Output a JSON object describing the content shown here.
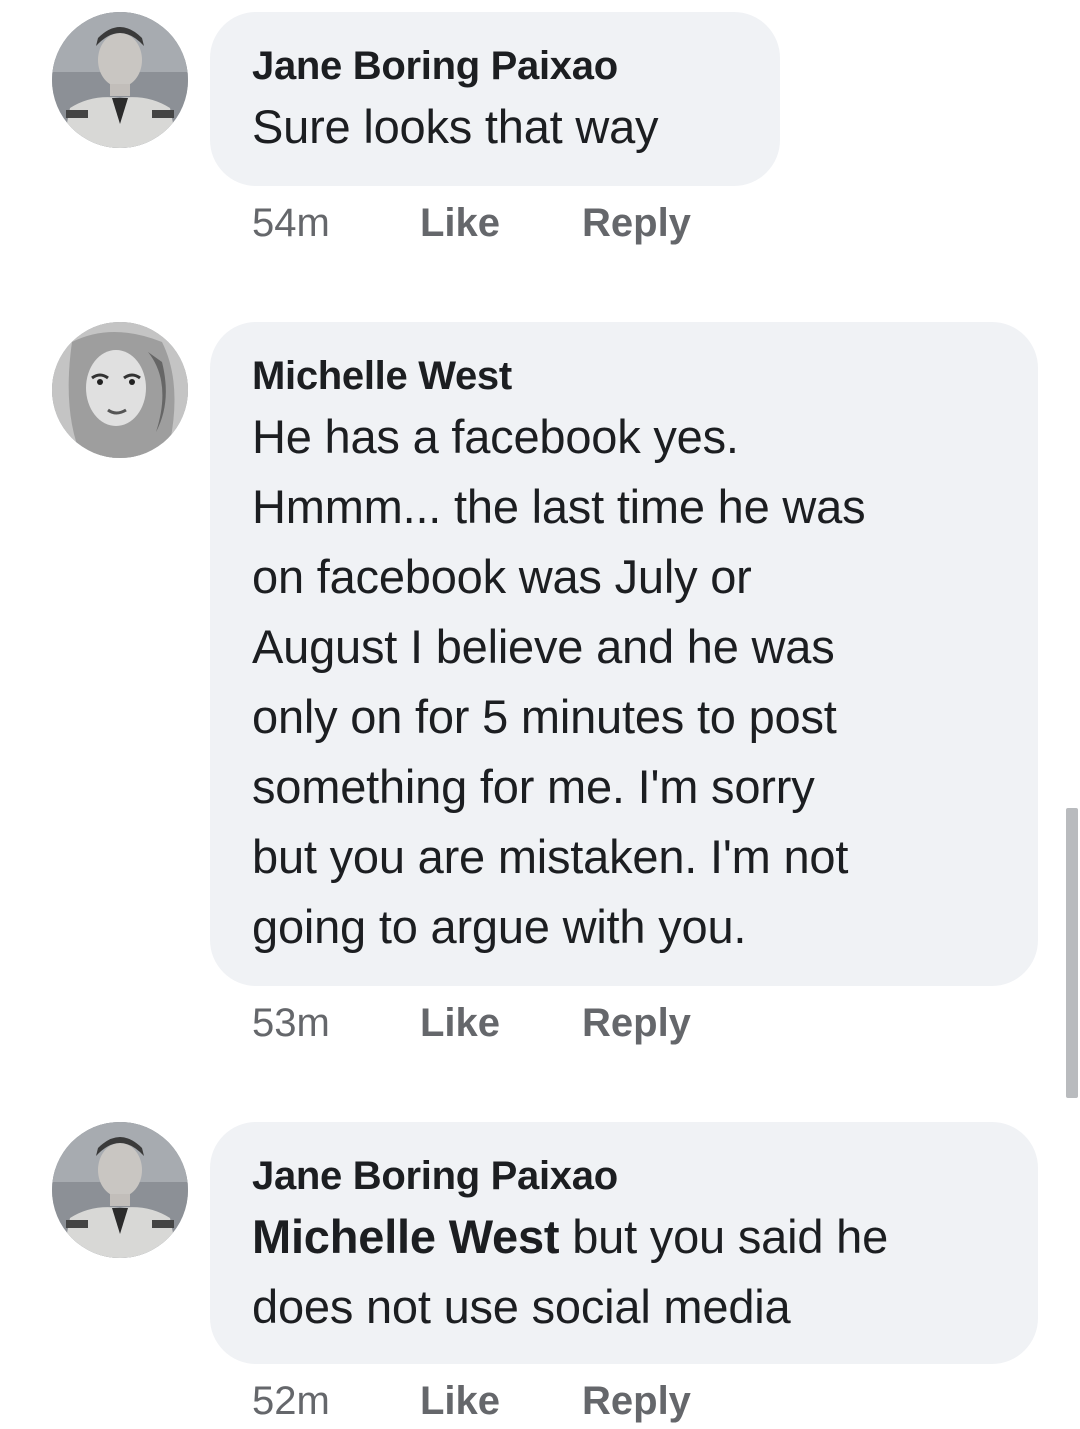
{
  "comments": [
    {
      "author": "Jane Boring Paixao",
      "avatar_icon": "profile-photo-man-uniform",
      "text": "Sure looks that way",
      "time": "54m",
      "like": "Like",
      "reply": "Reply"
    },
    {
      "author": "Michelle West",
      "avatar_icon": "profile-photo-woman-sketch",
      "text_lines": [
        "He has a facebook yes.",
        "Hmmm... the last time he was",
        "on facebook was July or",
        "August I believe and he was",
        "only on for 5 minutes to post",
        "something for me. I'm sorry",
        "but you are mistaken. I'm not",
        "going to argue with you."
      ],
      "time": "53m",
      "like": "Like",
      "reply": "Reply"
    },
    {
      "author": "Jane Boring Paixao",
      "avatar_icon": "profile-photo-man-uniform",
      "mention": "Michelle West",
      "text_after_mention": " but you said he",
      "text_line2": "does not use social media",
      "time": "52m",
      "like": "Like",
      "reply": "Reply"
    }
  ],
  "colors": {
    "bubble_bg": "#f0f2f5",
    "meta_text": "#65676b",
    "primary_text": "#1c1e21"
  }
}
